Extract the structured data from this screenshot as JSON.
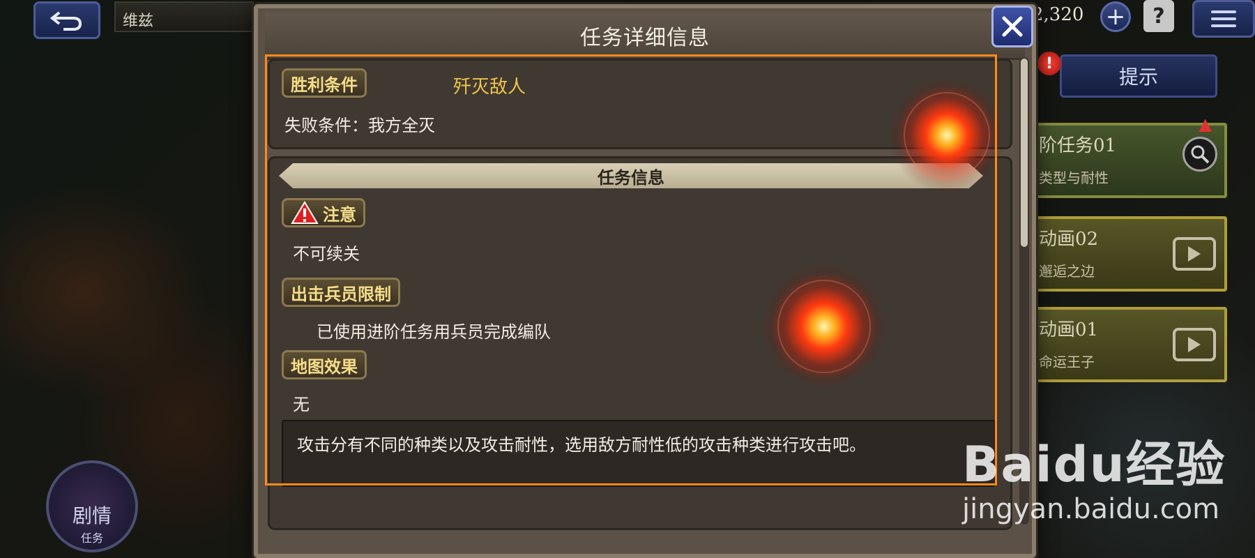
{
  "topbar": {
    "stage_title": "维兹",
    "currency_value": "2,320",
    "plus_label": "+",
    "help_label": "?"
  },
  "right_panel": {
    "hint_label": "提示",
    "alert_badge": "!",
    "cards": [
      {
        "title": "阶任务01",
        "subtitle": "类型与耐性"
      },
      {
        "title": "动画02",
        "subtitle": "邂逅之边"
      },
      {
        "title": "动画01",
        "subtitle": "命运王子"
      }
    ]
  },
  "story_button": {
    "label": "剧情",
    "sub": "任务"
  },
  "dialog": {
    "title": "任务详细信息",
    "victory_tag": "胜利条件",
    "victory_value": "歼灭敌人",
    "defeat_text": "失败条件：我方全灭",
    "section_title": "任务信息",
    "notice_tag": "注意",
    "notice_value": "不可续关",
    "limit_tag": "出击兵员限制",
    "limit_value": "已使用进阶任务用兵员完成编队",
    "map_effect_tag": "地图效果",
    "map_effect_value": "无",
    "tip_text": "攻击分有不同的种类以及攻击耐性，选用敌方耐性低的攻击种类进行攻击吧。"
  },
  "watermark": {
    "brand": "Baidu经验",
    "url": "jingyan.baidu.com"
  },
  "colors": {
    "highlight_frame": "#ff8a1a",
    "tag_text": "#f6dd88",
    "victory_value": "#f0c44a",
    "close_button": "#2f3f92"
  }
}
